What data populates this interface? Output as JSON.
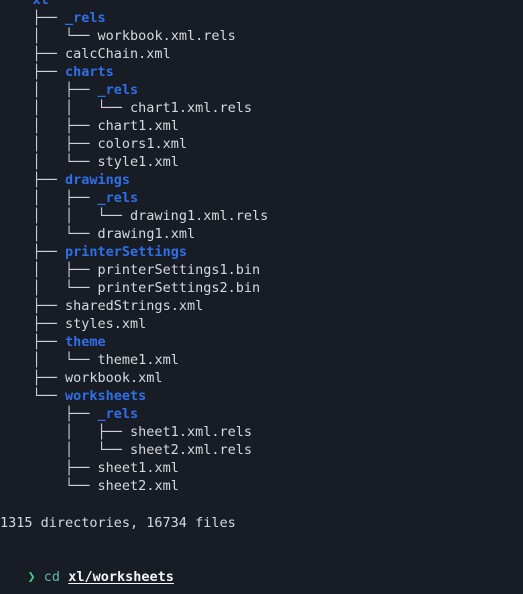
{
  "terminal": {
    "background_color": "#181c24",
    "directory_color": "#2f6fe8",
    "file_color": "#d6d9de",
    "branch_color": "#cfd3d9",
    "prompt_symbol_color": "#3fd07f",
    "command_color": "#5fb8a8",
    "argument_color": "#f2f4f7"
  },
  "tree": {
    "rows": [
      {
        "prefix": "└── ",
        "name": "xl",
        "type": "dir"
      },
      {
        "prefix": "    ├── ",
        "name": "_rels",
        "type": "dir"
      },
      {
        "prefix": "    │   └── ",
        "name": "workbook.xml.rels",
        "type": "file"
      },
      {
        "prefix": "    ├── ",
        "name": "calcChain.xml",
        "type": "file"
      },
      {
        "prefix": "    ├── ",
        "name": "charts",
        "type": "dir"
      },
      {
        "prefix": "    │   ├── ",
        "name": "_rels",
        "type": "dir"
      },
      {
        "prefix": "    │   │   └── ",
        "name": "chart1.xml.rels",
        "type": "file"
      },
      {
        "prefix": "    │   ├── ",
        "name": "chart1.xml",
        "type": "file"
      },
      {
        "prefix": "    │   ├── ",
        "name": "colors1.xml",
        "type": "file"
      },
      {
        "prefix": "    │   └── ",
        "name": "style1.xml",
        "type": "file"
      },
      {
        "prefix": "    ├── ",
        "name": "drawings",
        "type": "dir"
      },
      {
        "prefix": "    │   ├── ",
        "name": "_rels",
        "type": "dir"
      },
      {
        "prefix": "    │   │   └── ",
        "name": "drawing1.xml.rels",
        "type": "file"
      },
      {
        "prefix": "    │   └── ",
        "name": "drawing1.xml",
        "type": "file"
      },
      {
        "prefix": "    ├── ",
        "name": "printerSettings",
        "type": "dir"
      },
      {
        "prefix": "    │   ├── ",
        "name": "printerSettings1.bin",
        "type": "file"
      },
      {
        "prefix": "    │   └── ",
        "name": "printerSettings2.bin",
        "type": "file"
      },
      {
        "prefix": "    ├── ",
        "name": "sharedStrings.xml",
        "type": "file"
      },
      {
        "prefix": "    ├── ",
        "name": "styles.xml",
        "type": "file"
      },
      {
        "prefix": "    ├── ",
        "name": "theme",
        "type": "dir"
      },
      {
        "prefix": "    │   └── ",
        "name": "theme1.xml",
        "type": "file"
      },
      {
        "prefix": "    ├── ",
        "name": "workbook.xml",
        "type": "file"
      },
      {
        "prefix": "    └── ",
        "name": "worksheets",
        "type": "dir"
      },
      {
        "prefix": "        ├── ",
        "name": "_rels",
        "type": "dir"
      },
      {
        "prefix": "        │   ├── ",
        "name": "sheet1.xml.rels",
        "type": "file"
      },
      {
        "prefix": "        │   └── ",
        "name": "sheet2.xml.rels",
        "type": "file"
      },
      {
        "prefix": "        ├── ",
        "name": "sheet1.xml",
        "type": "file"
      },
      {
        "prefix": "        └── ",
        "name": "sheet2.xml",
        "type": "file"
      }
    ]
  },
  "summary": {
    "text": "1315 directories, 16734 files",
    "directories": 1315,
    "files": 16734
  },
  "prompt": {
    "symbol": "❯",
    "command": "cd",
    "argument": "xl/worksheets"
  }
}
